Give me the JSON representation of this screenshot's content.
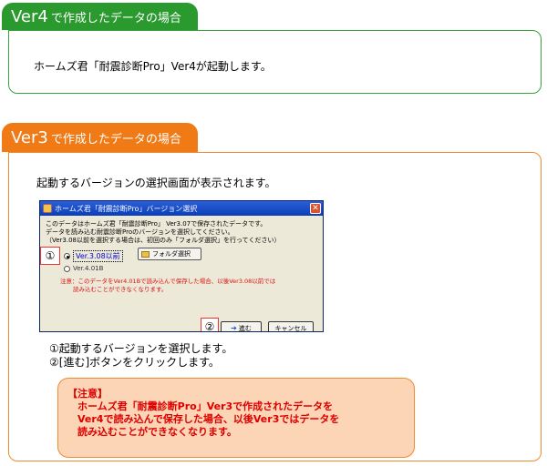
{
  "section_ver4": {
    "tab_big": "Ver4",
    "tab_small": "で作成したデータの場合",
    "text": "ホームズ君「耐震診断Pro」Ver4が起動します。"
  },
  "section_ver3": {
    "tab_big": "Ver3",
    "tab_small": "で作成したデータの場合",
    "intro": "起動するバージョンの選択画面が表示されます。",
    "dialog": {
      "title": "ホームズ君「耐震診断Pro」バージョン選択",
      "close_glyph": "✕",
      "message_1": "このデータはホームズ君「耐震診断Pro」 Ver3.07で保存されたデータです。",
      "message_2": "データを読み込む耐震診断Proのバージョンを選択してください。",
      "message_3": "（Ver3.08以前を選択する場合は、初回のみ「フォルダ選択」を行ってください）",
      "option_1": "Ver.3.08以前",
      "folder_button": "フォルダ選択",
      "option_2": "Ver.4.01B",
      "warning_1": "注意：このデータをVer4.01Bで読み込んで保存した場合、以後Ver3.08以前では",
      "warning_2": "読み込むことができなくなります。",
      "go_button": "進む",
      "cancel_button": "キャンセル",
      "marker_1": "①",
      "marker_2": "②"
    },
    "steps": [
      "①起動するバージョンを選択します。",
      "②[進む]ボタンをクリックします。"
    ],
    "caution": {
      "heading": "【注意】",
      "line_1": "　ホームズ君「耐震診断Pro」Ver3で作成されたデータを",
      "line_2": "　Ver4で読み込んで保存した場合、以後Ver3ではデータを",
      "line_3": "　読み込むことができなくなります。"
    }
  },
  "colors": {
    "green": "#2a9a2f",
    "orange": "#f07a16",
    "caution_bg": "#fcd5b6",
    "warning_red": "#d11111"
  }
}
